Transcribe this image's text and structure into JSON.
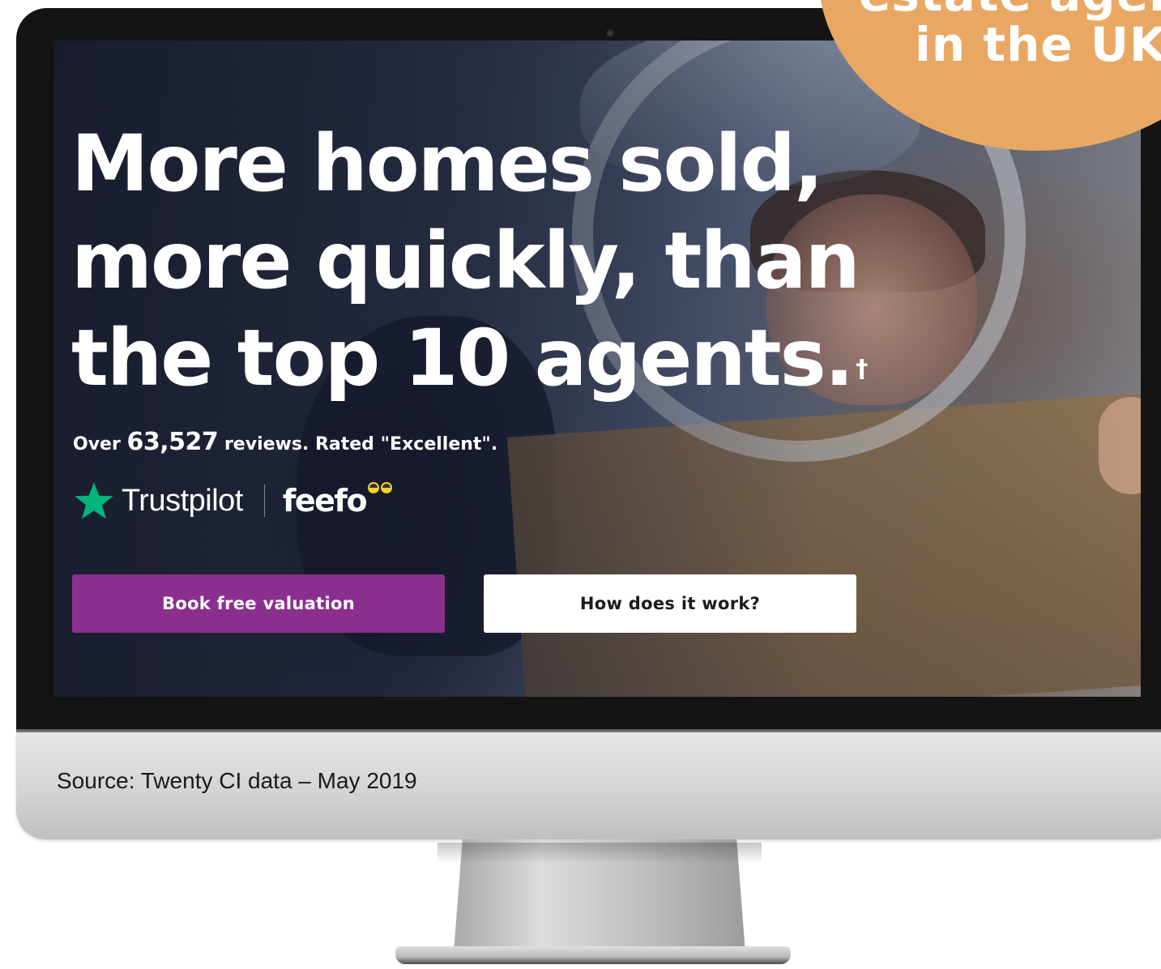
{
  "hero": {
    "headline_line1": "More homes sold,",
    "headline_line2": "more quickly, than",
    "headline_line3": "the top 10 agents.",
    "footnote_mark": "†",
    "reviews_prefix": "Over",
    "reviews_count": "63,527",
    "reviews_suffix": "reviews. Rated \"Excellent\".",
    "trustpilot_label": "Trustpilot",
    "feefo_label": "feefo",
    "primary_button": "Book free valuation",
    "secondary_button": "How does it work?"
  },
  "badge": {
    "line1": "estate agent",
    "line2": "in the UK"
  },
  "source_note": "Source: Twenty CI data – May 2019",
  "colors": {
    "primary_button": "#8b2f8f",
    "secondary_button": "#ffffff",
    "badge": "#e8a864",
    "trustpilot_star": "#00b67a",
    "feefo_eyes": "#f5d21c"
  },
  "icons": {
    "trustpilot": "star-icon",
    "feefo": "feefo-eyes-icon"
  }
}
